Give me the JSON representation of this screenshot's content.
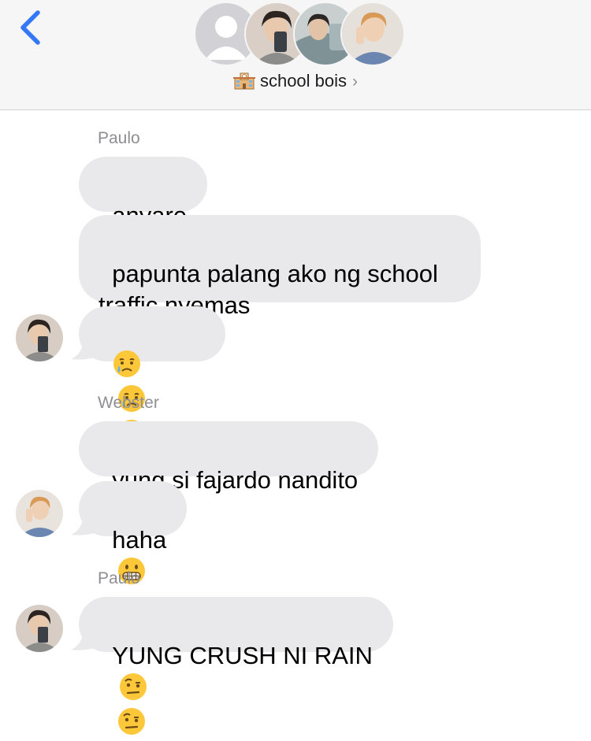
{
  "header": {
    "back_icon": "chevron-left-icon",
    "group_icon": "school-building-icon",
    "group_name": "school bois",
    "chevron": "›",
    "accent_color": "#3478f6"
  },
  "messages": [
    {
      "sender": "Paulo",
      "text": "anyare"
    },
    {
      "text": "papunta palang ako ng school\ntraffic nyemas"
    },
    {
      "emojis": [
        "crying-face-emoji",
        "crying-face-emoji",
        "crying-face-emoji"
      ],
      "avatar": "paulo-avatar"
    },
    {
      "sender": "Webster",
      "text": "yung si fajardo nandito"
    },
    {
      "text": "haha",
      "emojis": [
        "grimacing-face-emoji"
      ],
      "avatar": "webster-avatar"
    },
    {
      "sender": "Paulo",
      "text": "YUNG CRUSH NI RAIN",
      "emojis": [
        "face-with-raised-eyebrow-emoji",
        "face-with-raised-eyebrow-emoji"
      ],
      "avatar": "paulo-avatar"
    }
  ],
  "colors": {
    "bubble": "#e9e9eb",
    "sender_name": "#8e8e93",
    "header_bg": "#f6f6f7"
  }
}
